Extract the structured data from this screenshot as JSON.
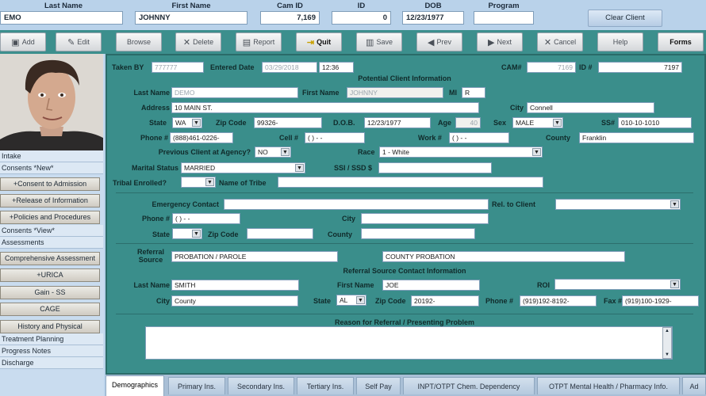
{
  "header": {
    "labels": {
      "last_name": "Last Name",
      "first_name": "First Name",
      "cam_id": "Cam ID",
      "id": "ID",
      "dob": "DOB",
      "program": "Program"
    },
    "values": {
      "last_name": "EMO",
      "first_name": "JOHNNY",
      "cam_id": "7,169",
      "id": "0",
      "dob": "12/23/1977",
      "program": ""
    },
    "clear_client": "Clear Client"
  },
  "toolbar": {
    "add": "Add",
    "edit": "Edit",
    "browse": "Browse",
    "delete": "Delete",
    "report": "Report",
    "quit": "Quit",
    "save": "Save",
    "prev": "Prev",
    "next": "Next",
    "cancel": "Cancel",
    "help": "Help",
    "forms": "Forms"
  },
  "sidebar": {
    "intake": "Intake",
    "consents_new": "Consents *New*",
    "consent_admission": "+Consent to Admission",
    "release_info": "+Release of Information",
    "policies": "+Policies and Procedures",
    "consents_view": "Consents *View*",
    "assessments": "Assessments",
    "comprehensive": "Comprehensive Assessment",
    "urica": "+URICA",
    "gain": "Gain - SS",
    "cage": "CAGE",
    "history": "History and Physical",
    "treatment": "Treatment Planning",
    "progress": "Progress Notes",
    "discharge": "Discharge"
  },
  "form": {
    "taken_by_label": "Taken BY",
    "taken_by": "777777",
    "entered_date_label": "Entered Date",
    "entered_date": "03/29/2018",
    "entered_time": "12:36",
    "cam_label": "CAM#",
    "cam_value": "7169",
    "id_label": "ID #",
    "id_value": "7197",
    "potential_title": "Potential Client Information",
    "last_name_label": "Last Name",
    "last_name": "DEMO",
    "first_name_label": "First Name",
    "first_name": "JOHNNY",
    "mi_label": "MI",
    "mi": "R",
    "address_label": "Address",
    "address": "10 MAIN ST.",
    "city_label": "City",
    "city": "Connell",
    "state_label": "State",
    "state": "WA",
    "zip_label": "Zip Code",
    "zip": "99326-",
    "dob_label": "D.O.B.",
    "dob": "12/23/1977",
    "age_label": "Age",
    "age": "40",
    "sex_label": "Sex",
    "sex": "MALE",
    "ssn_label": "SS#",
    "ssn": "010-10-1010",
    "phone_label": "Phone #",
    "phone": "(888)461-0226-",
    "cell_label": "Cell #",
    "cell": "(  )   -   -",
    "work_label": "Work #",
    "work": "(  )   -   -",
    "county_label": "County",
    "county": "Franklin",
    "prev_client_label": "Previous Client at Agency?",
    "prev_client": "NO",
    "race_label": "Race",
    "race": "1 - White",
    "marital_label": "Marital Status",
    "marital": "MARRIED",
    "ssi_label": "SSI / SSD $",
    "ssi": "",
    "tribal_label": "Tribal Enrolled?",
    "tribal": "",
    "tribe_name_label": "Name of Tribe",
    "tribe_name": "",
    "emergency_label": "Emergency Contact",
    "emergency": "",
    "rel_label": "Rel. to Client",
    "rel": "",
    "e_phone_label": "Phone #",
    "e_phone": "(  )   -   -",
    "e_city_label": "City",
    "e_city": "",
    "e_state_label": "State",
    "e_state": "",
    "e_zip_label": "Zip Code",
    "e_zip": "",
    "e_county_label": "County",
    "e_county": "",
    "referral_source_label": "Referral Source",
    "referral_source": "PROBATION / PAROLE",
    "referral_source_2": "COUNTY PROBATION",
    "ref_contact_title": "Referral Source Contact Information",
    "r_last_label": "Last Name",
    "r_last": "SMITH",
    "r_first_label": "First Name",
    "r_first": "JOE",
    "roi_label": "ROI",
    "roi": "",
    "r_city_label": "City",
    "r_city": "County",
    "r_state_label": "State",
    "r_state": "AL",
    "r_zip_label": "Zip Code",
    "r_zip": "20192-",
    "r_phone_label": "Phone #",
    "r_phone": "(919)192-8192-",
    "r_fax_label": "Fax #",
    "r_fax": "(919)100-1929-",
    "reason_title": "Reason for Referral / Presenting Problem",
    "reason": ""
  },
  "tabs": [
    "Demographics",
    "Primary Ins.",
    "Secondary Ins.",
    "Tertiary Ins.",
    "Self Pay",
    "INPT/OTPT Chem. Dependency",
    "OTPT Mental Health / Pharmacy Info.",
    "Ad"
  ]
}
